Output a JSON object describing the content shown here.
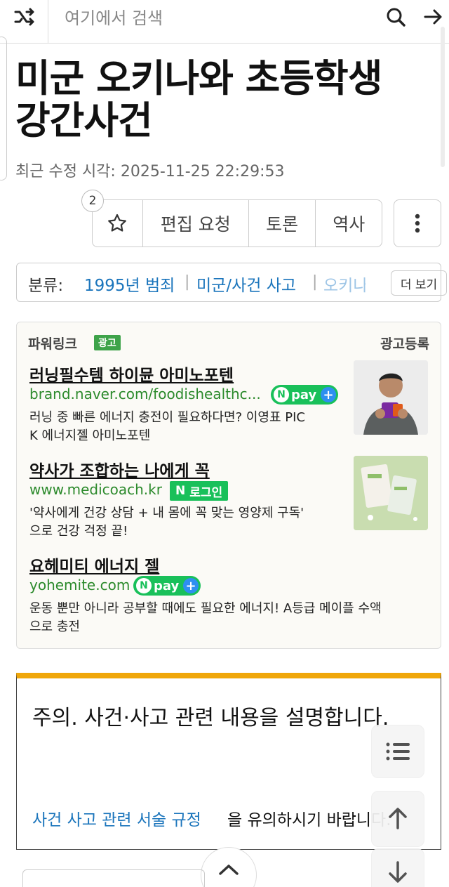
{
  "search": {
    "placeholder": "여기에서 검색"
  },
  "title": {
    "line1": "미군 오키나와 초등학생",
    "line2": "강간사건"
  },
  "modified": "최근 수정 시각: 2025-11-25 22:29:53",
  "actions": {
    "badge": "2",
    "edit": "편집 요청",
    "discuss": "토론",
    "history": "역사"
  },
  "categories": {
    "label": "분류:",
    "items": [
      "1995년 범죄",
      "미군/사건 사고",
      "오키나와"
    ],
    "more": "더 보기"
  },
  "ad": {
    "powerlink": "파워링크",
    "tag": "광고",
    "register": "광고등록",
    "items": [
      {
        "title": "러닝필수템 하이뮨 아미노포텐",
        "url": "brand.naver.com/foodishealthc...",
        "badge": "pay",
        "desc1": "러닝 중 빠른 에너지 충전이 필요하다면? 이영표 PIC",
        "desc2": "K 에너지젤 아미노포텐"
      },
      {
        "title": "약사가 조합하는 나에게 꼭",
        "url": "www.medicoach.kr",
        "badge": "로그인",
        "desc1": "'약사에게 건강 상담 + 내 몸에 꼭 맞는 영양제 구독'",
        "desc2": "으로 건강 걱정 끝!"
      },
      {
        "title": "요헤미티 에너지 젤",
        "url": "yohemite.com",
        "badge": "pay",
        "desc1": "운동 뿐만 아니라 공부할 때에도 필요한 에너지! A등급 메이플 수액",
        "desc2": "으로 충전"
      }
    ]
  },
  "caution": {
    "heading": "주의. 사건·사고 관련 내용을 설명합니다.",
    "rule_link": "사건 사고 관련 서술 규정",
    "rule_tail": "을 유의하시기 바랍니다."
  },
  "colors": {
    "link": "#1b75bc",
    "ad_url": "#2c8a2c",
    "naver_green": "#19c05a",
    "warning_bar": "#f0a70a"
  },
  "icons": [
    "shuffle-icon",
    "search-icon",
    "arrow-right-icon",
    "star-icon",
    "kebab-menu-icon",
    "list-icon",
    "arrow-up-icon",
    "arrow-down-icon",
    "chevron-up-icon"
  ]
}
